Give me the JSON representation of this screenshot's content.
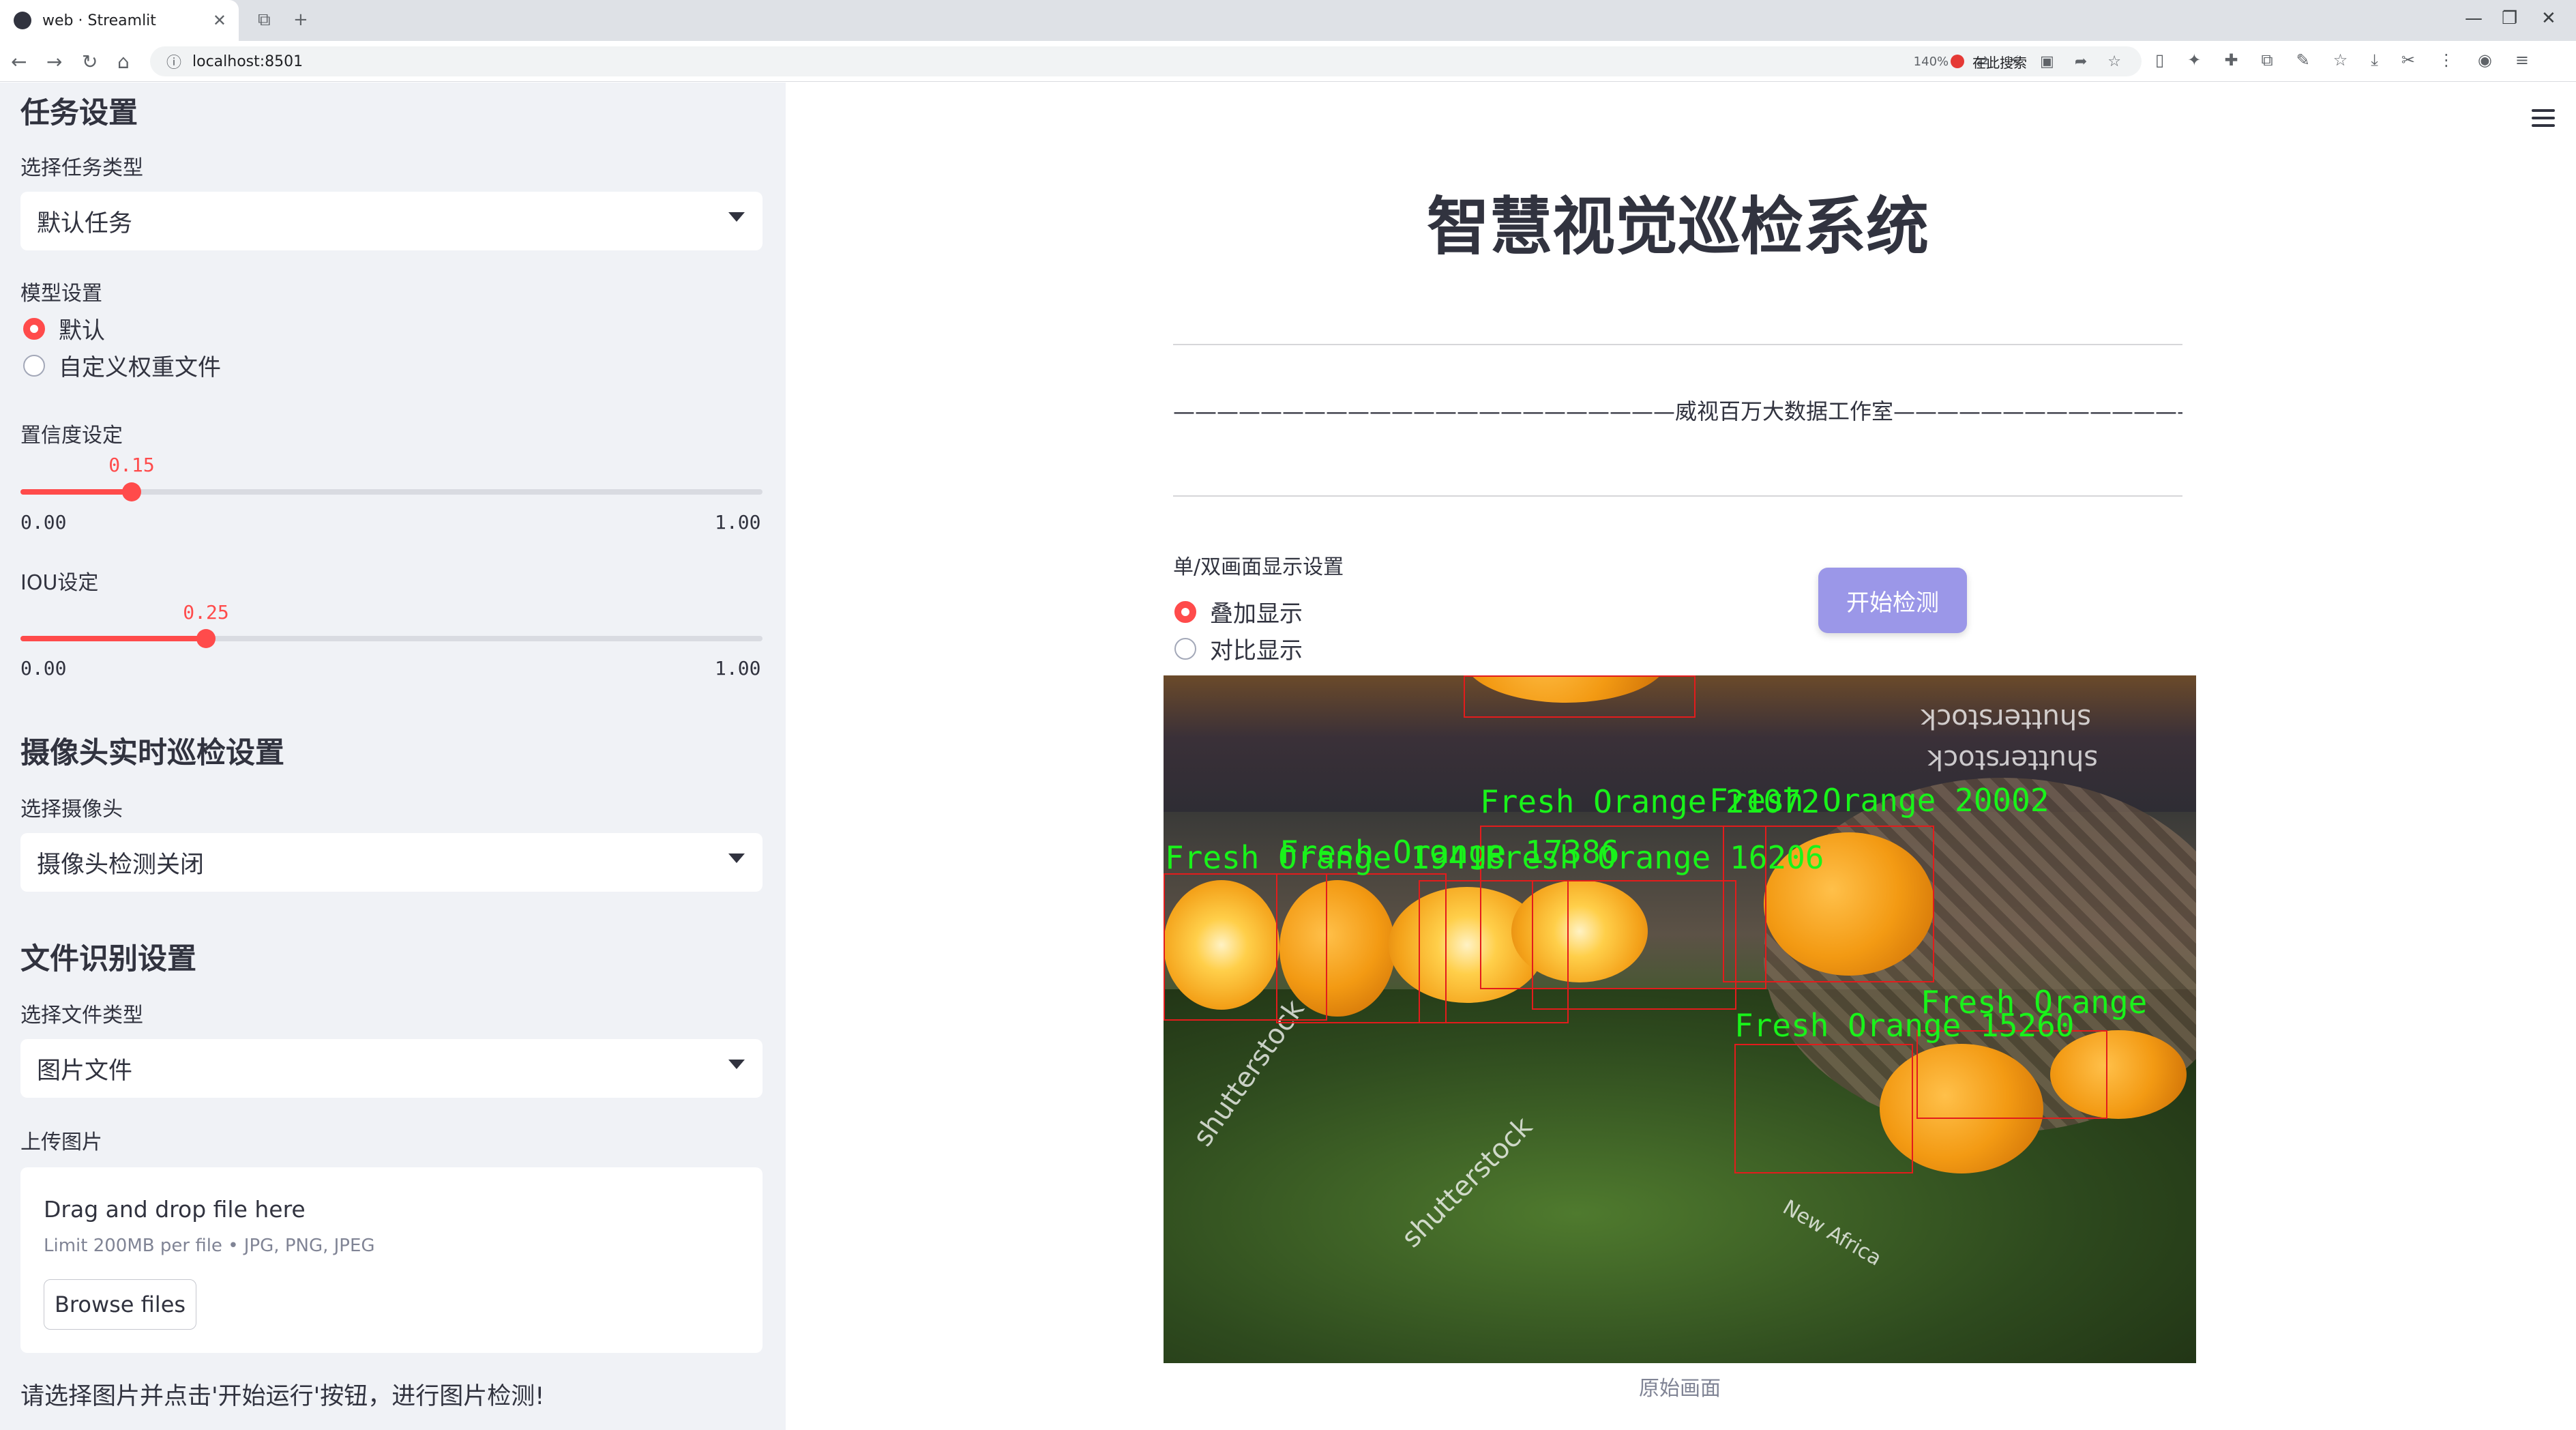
{
  "browser": {
    "tab_title": "web · Streamlit",
    "url": "localhost:8501",
    "zoom": "140%",
    "search_placeholder": "在此搜索"
  },
  "sidebar": {
    "task_heading": "任务设置",
    "task_type_label": "选择任务类型",
    "task_type_value": "默认任务",
    "model_label": "模型设置",
    "model_options": [
      "默认",
      "自定义权重文件"
    ],
    "model_selected": "默认",
    "conf_label": "置信度设定",
    "conf_value": "0.15",
    "conf_min": "0.00",
    "conf_max": "1.00",
    "conf_fraction": 0.15,
    "iou_label": "IOU设定",
    "iou_value": "0.25",
    "iou_min": "0.00",
    "iou_max": "1.00",
    "iou_fraction": 0.25,
    "camera_heading": "摄像头实时巡检设置",
    "camera_label": "选择摄像头",
    "camera_value": "摄像头检测关闭",
    "file_heading": "文件识别设置",
    "file_type_label": "选择文件类型",
    "file_type_value": "图片文件",
    "upload_label": "上传图片",
    "upload_drag": "Drag and drop file here",
    "upload_limit": "Limit 200MB per file • JPG, PNG, JPEG",
    "browse_label": "Browse files",
    "hint": "请选择图片并点击'开始运行'按钮，进行图片检测!"
  },
  "main": {
    "title": "智慧视觉巡检系统",
    "studio_line": "———————————————————————威视百万大数据工作室————————————————————————",
    "display_label": "单/双画面显示设置",
    "display_options": [
      "叠加显示",
      "对比显示"
    ],
    "display_selected": "叠加显示",
    "start_button": "开始检测",
    "image_caption": "原始画面"
  },
  "detections": [
    {
      "label": "Fresh Orange 21072"
    },
    {
      "label": "Fresh Orange 20002"
    },
    {
      "label": "Fresh Orange 19418"
    },
    {
      "label": "Fresh Orange 17386"
    },
    {
      "label": "Fresh Orange 16206"
    },
    {
      "label": "Fresh Orange 15260"
    },
    {
      "label": "Fresh Orange"
    }
  ],
  "watermarks": [
    "shutterstock",
    "shutterstock",
    "shutterstock",
    "shutterstock",
    "New Africa"
  ]
}
